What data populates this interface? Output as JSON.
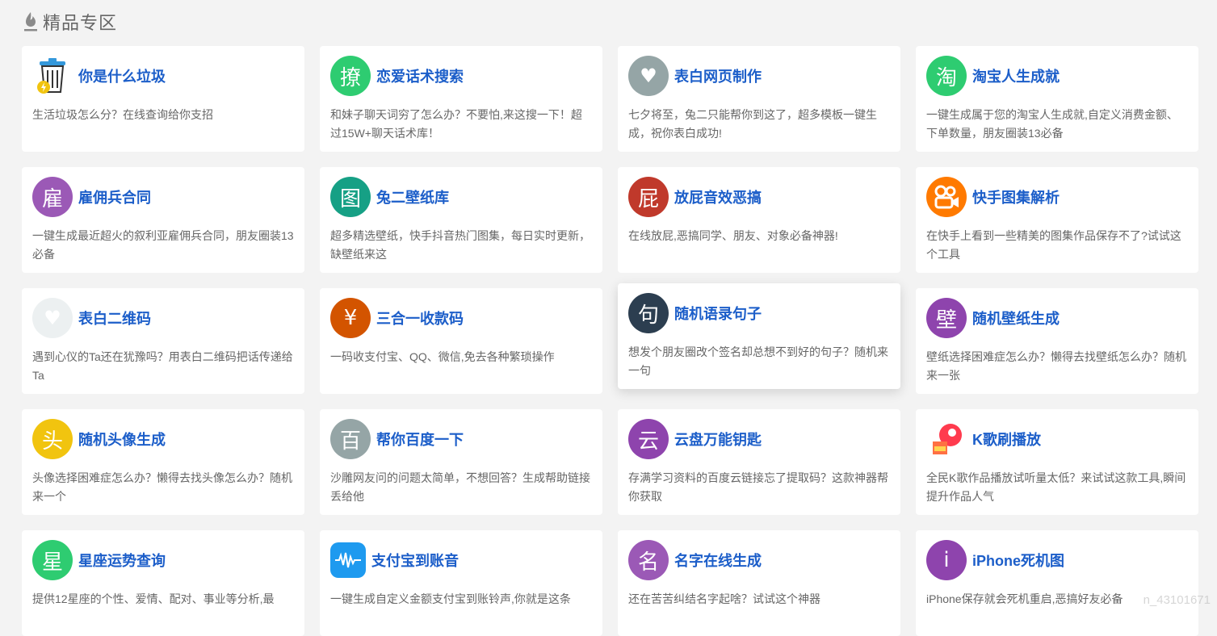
{
  "header": {
    "title": "精品专区"
  },
  "cards": [
    {
      "name": "你是什么垃圾",
      "desc": "生活垃圾怎么分？在线查询给你支招",
      "icon_type": "trash",
      "icon_text": "",
      "color": "#ffffff"
    },
    {
      "name": "恋爱话术搜索",
      "desc": "和妹子聊天词穷了怎么办？不要怕,来这搜一下！超过15W+聊天话术库！",
      "icon_type": "char",
      "icon_text": "撩",
      "color": "#2ecc71"
    },
    {
      "name": "表白网页制作",
      "desc": "七夕将至，兔二只能帮你到这了，超多模板一键生成，祝你表白成功!",
      "icon_type": "char",
      "icon_text": "♥",
      "color": "#95a5a6"
    },
    {
      "name": "淘宝人生成就",
      "desc": "一键生成属于您的淘宝人生成就,自定义消费金额、下单数量，朋友圈装13必备",
      "icon_type": "char",
      "icon_text": "淘",
      "color": "#2ecc71"
    },
    {
      "name": "雇佣兵合同",
      "desc": "一键生成最近超火的叙利亚雇佣兵合同，朋友圈装13必备",
      "icon_type": "char",
      "icon_text": "雇",
      "color": "#9b59b6"
    },
    {
      "name": "兔二壁纸库",
      "desc": "超多精选壁纸，快手抖音热门图集，每日实时更新，缺壁纸来这",
      "icon_type": "char",
      "icon_text": "图",
      "color": "#16a085"
    },
    {
      "name": "放屁音效恶搞",
      "desc": "在线放屁,恶搞同学、朋友、对象必备神器!",
      "icon_type": "char",
      "icon_text": "屁",
      "color": "#c0392b"
    },
    {
      "name": "快手图集解析",
      "desc": "在快手上看到一些精美的图集作品保存不了?试试这个工具",
      "icon_type": "kuaishou",
      "icon_text": "",
      "color": "#ff7a00"
    },
    {
      "name": "表白二维码",
      "desc": "遇到心仪的Ta还在犹豫吗？用表白二维码把话传递给Ta",
      "icon_type": "char",
      "icon_text": "♥",
      "color": "#ecf0f1"
    },
    {
      "name": "三合一收款码",
      "desc": "一码收支付宝、QQ、微信,免去各种繁琐操作",
      "icon_type": "char",
      "icon_text": "¥",
      "color": "#d35400"
    },
    {
      "name": "随机语录句子",
      "desc": "想发个朋友圈改个签名却总想不到好的句子？随机来一句",
      "icon_type": "char",
      "icon_text": "句",
      "color": "#2c3e50"
    },
    {
      "name": "随机壁纸生成",
      "desc": "壁纸选择困难症怎么办？懒得去找壁纸怎么办？随机来一张",
      "icon_type": "char",
      "icon_text": "壁",
      "color": "#8e44ad"
    },
    {
      "name": "随机头像生成",
      "desc": "头像选择困难症怎么办？懒得去找头像怎么办？随机来一个",
      "icon_type": "char",
      "icon_text": "头",
      "color": "#f1c40f"
    },
    {
      "name": "帮你百度一下",
      "desc": "沙雕网友问的问题太简单，不想回答？生成帮助链接丢给他",
      "icon_type": "char",
      "icon_text": "百",
      "color": "#95a5a6"
    },
    {
      "name": "云盘万能钥匙",
      "desc": "存满学习资料的百度云链接忘了提取码？这款神器帮你获取",
      "icon_type": "char",
      "icon_text": "云",
      "color": "#8e44ad"
    },
    {
      "name": "K歌刷播放",
      "desc": "全民K歌作品播放试听量太低？来试试这款工具,瞬间提升作品人气",
      "icon_type": "kge",
      "icon_text": "",
      "color": "#ff3b4e"
    },
    {
      "name": "星座运势查询",
      "desc": "提供12星座的个性、爱情、配对、事业等分析,最",
      "icon_type": "char",
      "icon_text": "星",
      "color": "#2ecc71"
    },
    {
      "name": "支付宝到账音",
      "desc": "一键生成自定义金额支付宝到账铃声,你就是这条",
      "icon_type": "alipay",
      "icon_text": "",
      "color": "#1e9aef"
    },
    {
      "name": "名字在线生成",
      "desc": "还在苦苦纠结名字起啥？试试这个神器",
      "icon_type": "char",
      "icon_text": "名",
      "color": "#9b59b6"
    },
    {
      "name": "iPhone死机图",
      "desc": "iPhone保存就会死机重启,恶搞好友必备",
      "icon_type": "char",
      "icon_text": "i",
      "color": "#8e44ad"
    }
  ],
  "watermark": "n_43101671",
  "raised_card_index": 10
}
